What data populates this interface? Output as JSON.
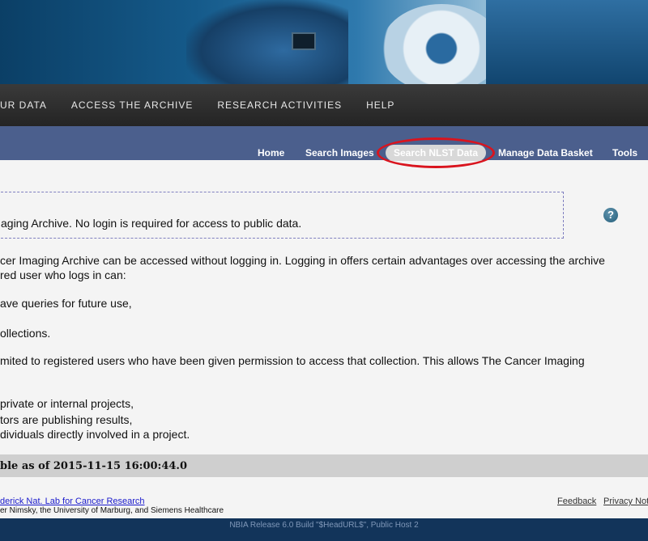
{
  "top_nav": [
    "UR DATA",
    "ACCESS THE ARCHIVE",
    "RESEARCH ACTIVITIES",
    "HELP"
  ],
  "sub_nav": {
    "home": "Home",
    "search_images": "Search Images",
    "search_nlst": "Search NLST Data",
    "manage_basket": "Manage Data Basket",
    "tools": "Tools"
  },
  "notice": "aging Archive. No login is required for access to public data.",
  "help_glyph": "?",
  "content": [
    "cer Imaging Archive can be accessed without logging in. Logging in offers certain advantages over accessing the archive",
    "red user who logs in can:",
    "ave queries for future use,",
    "ollections.",
    "mited to registered users who have been given permission to access that collection. This allows The Cancer Imaging",
    "private or internal projects,",
    "tors are publishing results,",
    "dividuals directly involved in a project."
  ],
  "status": "ble as of 2015-11-15 16:00:44.0",
  "credits": {
    "link": "derick Nat. Lab for Cancer Research",
    "text": "er Nimsky, the University of Marburg, and Siemens Healthcare"
  },
  "footer_links": {
    "feedback": "Feedback",
    "privacy": "Privacy Not"
  },
  "footer": "NBIA Release 6.0 Build \"$HeadURL$\", Public Host 2"
}
